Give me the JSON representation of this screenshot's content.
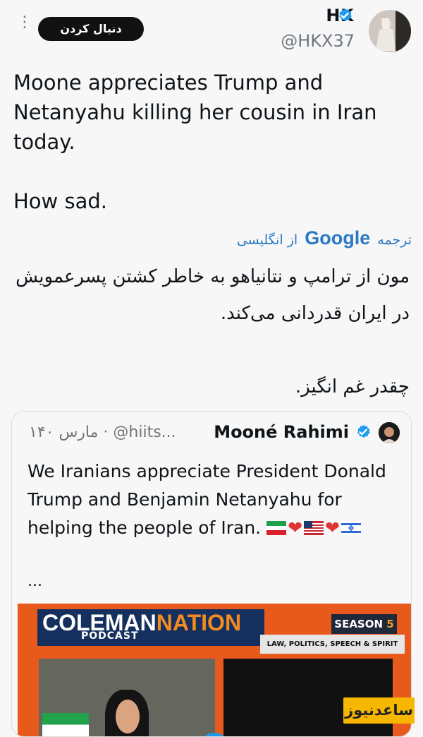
{
  "tweet": {
    "follow_label": "دنبال کردن",
    "author_name": "HK",
    "author_handle": "@HKX37",
    "text": "Moone appreciates Trump and Netanyahu killing her cousin in Iran today.\n\nHow sad.",
    "translation": {
      "prefix": "ترجمه",
      "provider": "Google",
      "suffix": "از انگلیسی",
      "text": "مون از ترامپ و نتانیاهو به خاطر کشتن پسرعمویش در ایران قدردانی می‌کند.\n\nچقدر غم انگیز."
    }
  },
  "quote": {
    "author_name": "Mooné Rahimi",
    "meta": "۱۴۰ مارس · @hiits...",
    "text": "We Iranians appreciate President Donald Trump and Benjamin Netanyahu for helping the people of Iran.",
    "ellipsis": "...",
    "media": {
      "brand_first": "COLEMAN",
      "brand_second": "NATION",
      "subtitle": "PODCAST",
      "season": "SEASON",
      "season_number": "5",
      "topics": "LAW, POLITICS, SPEECH & SPIRIT"
    }
  },
  "watermark": "ساعدنیوز",
  "colors": {
    "link": "#2b78c5",
    "verified": "#1d9bf0",
    "brand_orange": "#e75a1b",
    "brand_navy": "#15305e"
  }
}
